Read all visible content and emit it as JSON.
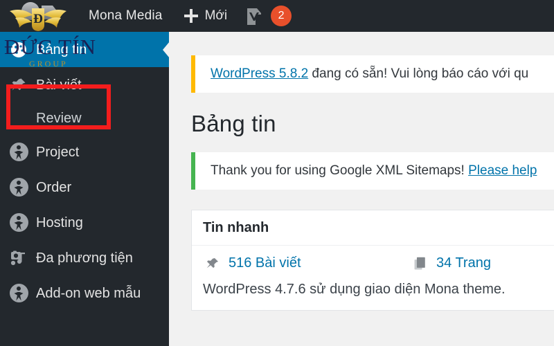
{
  "adminbar": {
    "logo_icon": "duc-tin-winged-emblem-logo",
    "site_name": "Mona Media",
    "new_icon": "plus-icon",
    "new_label": "Mới",
    "yoast_icon": "yoast-seo-icon",
    "notification_count": "2"
  },
  "watermark": {
    "main": "ĐỨC TÍN",
    "sub": "GROUP"
  },
  "sidebar": {
    "items": [
      {
        "label": "Bảng tin",
        "icon": "dashboard-icon",
        "current": true,
        "sub": false
      },
      {
        "label": "Bài viết",
        "icon": "pushpin-icon",
        "current": false,
        "sub": false
      },
      {
        "label": "Review",
        "icon": "",
        "current": false,
        "sub": true
      },
      {
        "label": "Project",
        "icon": "person-circle-icon",
        "current": false,
        "sub": false
      },
      {
        "label": "Order",
        "icon": "person-circle-icon",
        "current": false,
        "sub": false
      },
      {
        "label": "Hosting",
        "icon": "person-circle-icon",
        "current": false,
        "sub": false
      },
      {
        "label": "Đa phương tiện",
        "icon": "media-icon",
        "current": false,
        "sub": false
      },
      {
        "label": "Add-on web mẫu",
        "icon": "person-circle-icon",
        "current": false,
        "sub": false
      }
    ],
    "highlighted_item": "Bài viết"
  },
  "content": {
    "update_notice": {
      "link_text": "WordPress 5.8.2",
      "rest_text": " đang có sẵn! Vui lòng báo cáo với qu",
      "accent_color": "#ffb900"
    },
    "page_title": "Bảng tin",
    "sitemaps_notice": {
      "text": "Thank you for using Google XML Sitemaps! ",
      "link_text": "Please help",
      "accent_color": "#46b450"
    },
    "glance": {
      "title": "Tin nhanh",
      "posts": {
        "icon": "pushpin-icon",
        "label": "516 Bài viết"
      },
      "pages": {
        "icon": "pages-icon",
        "label": "34 Trang"
      },
      "version_text": "WordPress 4.7.6 sử dụng giao diện Mona theme."
    }
  },
  "colors": {
    "admin_dark": "#23282d",
    "admin_blue": "#0073aa",
    "page_bg": "#f1f1f1",
    "link": "#0073aa",
    "annotation_red": "#f41d1d",
    "badge_orange": "#e8502b"
  }
}
